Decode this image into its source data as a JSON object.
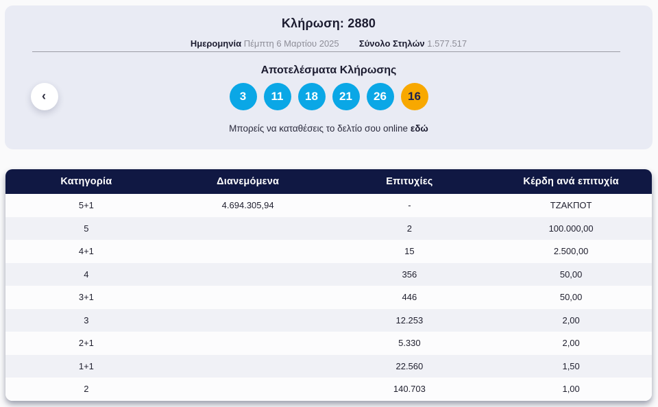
{
  "colors": {
    "ball_blue": "#0aa7e6",
    "ball_joker": "#f8a800",
    "header_navy": "#101843"
  },
  "nav": {
    "prev_label": "‹"
  },
  "draw": {
    "title": "Κλήρωση: 2880",
    "date_label": "Ημερομηνία",
    "date_value": "Πέμπτη 6 Μαρτίου 2025",
    "columns_label": "Σύνολο Στηλών",
    "columns_value": "1.577.517",
    "results_title": "Αποτελέσματα Κλήρωσης",
    "numbers": [
      "3",
      "11",
      "18",
      "21",
      "26"
    ],
    "joker": "16",
    "cta_text": "Μπορείς να καταθέσεις το δελτίο σου online",
    "cta_link": "εδώ"
  },
  "table": {
    "headers": [
      "Κατηγορία",
      "Διανεμόμενα",
      "Επιτυχίες",
      "Κέρδη ανά επιτυχία"
    ],
    "rows": [
      {
        "category": "5+1",
        "distributed": "4.694.305,94",
        "winners": "-",
        "prize": "ΤΖΑΚΠΟΤ"
      },
      {
        "category": "5",
        "distributed": "",
        "winners": "2",
        "prize": "100.000,00"
      },
      {
        "category": "4+1",
        "distributed": "",
        "winners": "15",
        "prize": "2.500,00"
      },
      {
        "category": "4",
        "distributed": "",
        "winners": "356",
        "prize": "50,00"
      },
      {
        "category": "3+1",
        "distributed": "",
        "winners": "446",
        "prize": "50,00"
      },
      {
        "category": "3",
        "distributed": "",
        "winners": "12.253",
        "prize": "2,00"
      },
      {
        "category": "2+1",
        "distributed": "",
        "winners": "5.330",
        "prize": "2,00"
      },
      {
        "category": "1+1",
        "distributed": "",
        "winners": "22.560",
        "prize": "1,50"
      },
      {
        "category": "2",
        "distributed": "",
        "winners": "140.703",
        "prize": "1,00"
      }
    ]
  }
}
